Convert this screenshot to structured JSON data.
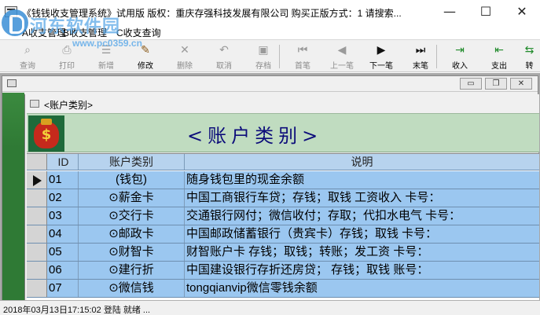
{
  "window": {
    "title": "《钱钱收支管理系统》试用版    版权：重庆存强科技发展有限公司    购买正版方式：1  请搜索...",
    "minimize_symbol": "—",
    "maximize_symbol": "☐",
    "close_symbol": "✕"
  },
  "watermark": {
    "title": "河东软件园",
    "url": "www.pc0359.cn"
  },
  "menu": {
    "items": [
      {
        "label": "A收支管理"
      },
      {
        "label": "B收支管理"
      },
      {
        "label": "C收支查询"
      }
    ]
  },
  "toolbar": {
    "buttons": [
      {
        "label": "查询",
        "icon": "magnifier-icon",
        "glyph": "⌕",
        "enabled": false
      },
      {
        "label": "打印",
        "icon": "printer-icon",
        "glyph": "⎙",
        "enabled": false
      },
      {
        "label": "新增",
        "icon": "new-record-icon",
        "glyph": "☰",
        "enabled": false
      },
      {
        "label": "修改",
        "icon": "edit-pencil-icon",
        "glyph": "✎",
        "enabled": true
      },
      {
        "label": "删除",
        "icon": "delete-x-icon",
        "glyph": "✕",
        "enabled": false
      },
      {
        "label": "取消",
        "icon": "undo-icon",
        "glyph": "↶",
        "enabled": false
      },
      {
        "label": "存档",
        "icon": "save-disk-icon",
        "glyph": "▣",
        "enabled": false
      },
      {
        "label": "首笔",
        "icon": "first-record-icon",
        "glyph": "⏮",
        "enabled": false
      },
      {
        "label": "上一笔",
        "icon": "previous-record-icon",
        "glyph": "◀",
        "enabled": false
      },
      {
        "label": "下一笔",
        "icon": "next-record-icon",
        "glyph": "▶",
        "enabled": true
      },
      {
        "label": "末笔",
        "icon": "last-record-icon",
        "glyph": "⏭",
        "enabled": true
      },
      {
        "label": "收入",
        "icon": "income-door-icon",
        "glyph": "⇥",
        "enabled": true
      },
      {
        "label": "支出",
        "icon": "expense-door-icon",
        "glyph": "⇤",
        "enabled": true
      },
      {
        "label": "转",
        "icon": "transfer-icon",
        "glyph": "⇆",
        "enabled": true
      }
    ]
  },
  "mdi": {
    "min_symbol": "▭",
    "restore_symbol": "❐",
    "close_symbol": "✕"
  },
  "account_window": {
    "title": "<账户类别>",
    "banner_title": "<账户类别>",
    "colors": {
      "banner": "#c0dcc0",
      "row": "#9bc7f0",
      "header": "#b7d3ee",
      "title_text": "#0c0c7a"
    }
  },
  "table": {
    "columns": [
      "ID",
      "账户类别",
      "说明"
    ],
    "rows": [
      {
        "id": "01",
        "category": "(钱包)",
        "desc": "随身钱包里的现金余额",
        "current": true
      },
      {
        "id": "02",
        "category": "⊙薪金卡",
        "desc": "中国工商银行车贷；存钱；取钱 工资收入        卡号：",
        "current": false
      },
      {
        "id": "03",
        "category": "⊙交行卡",
        "desc": "交通银行网付；微信收付；存取；代扣水电气 卡号：",
        "current": false
      },
      {
        "id": "04",
        "category": "⊙邮政卡",
        "desc": "中国邮政储蓄银行（贵宾卡）存钱；取钱        卡号：",
        "current": false
      },
      {
        "id": "05",
        "category": "⊙财智卡",
        "desc": "财智账户卡 存钱；取钱；转账；发工资          卡号：",
        "current": false
      },
      {
        "id": "06",
        "category": "⊙建行折",
        "desc": "中国建设银行存折还房贷；  存钱；取钱          账号：",
        "current": false
      },
      {
        "id": "07",
        "category": "⊙微信钱",
        "desc": "tongqianvip微信零钱余额",
        "current": false
      }
    ]
  },
  "status": {
    "text": "2018年03月13日17:15:02  登陆 就绪 ..."
  }
}
